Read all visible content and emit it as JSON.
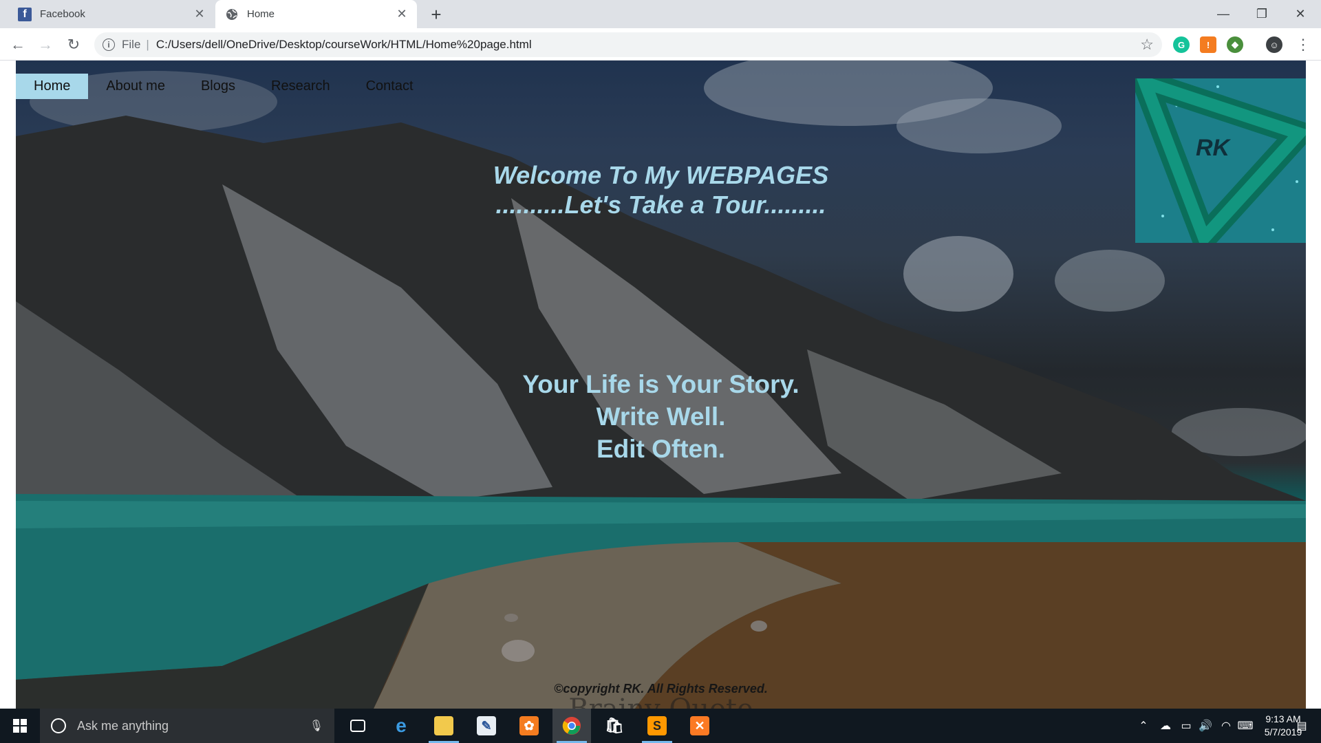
{
  "browser": {
    "tabs": [
      {
        "title": "Facebook",
        "icon": "facebook-icon"
      },
      {
        "title": "Home",
        "icon": "globe-icon"
      }
    ],
    "address": {
      "scheme_label": "File",
      "url": "C:/Users/dell/OneDrive/Desktop/courseWork/HTML/Home%20page.html"
    }
  },
  "page": {
    "nav": [
      {
        "label": "Home",
        "active": true
      },
      {
        "label": "About me",
        "active": false
      },
      {
        "label": "Blogs",
        "active": false
      },
      {
        "label": "Research",
        "active": false
      },
      {
        "label": "Contact",
        "active": false
      }
    ],
    "logo_text": "RK",
    "welcome_line1": "Welcome To My WEBPAGES",
    "welcome_line2": "..........Let's Take a Tour.........",
    "quote_line1": "Your Life is Your Story.",
    "quote_line2": "Write Well.",
    "quote_line3": "Edit Often.",
    "copyright": "©copyright RK. All Rights Reserved.",
    "faded_caption": "Brainy Quote",
    "colors": {
      "accent": "#a8d8ea",
      "logo_bg": "#1c7f8a"
    }
  },
  "taskbar": {
    "search_placeholder": "Ask me anything",
    "time": "9:13 AM",
    "date": "5/7/2019"
  }
}
